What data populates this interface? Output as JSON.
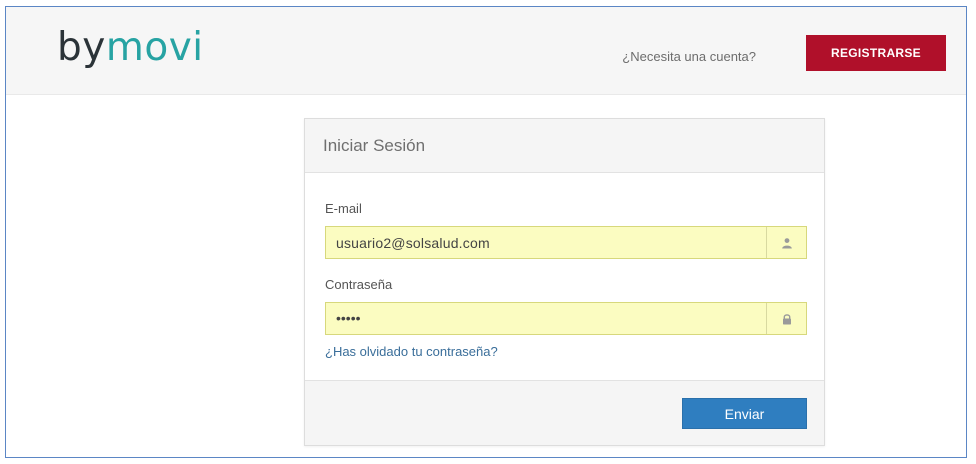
{
  "header": {
    "logo_part1": "by",
    "logo_part2": "movi",
    "need_account_text": "¿Necesita una cuenta?",
    "register_button_label": "REGISTRARSE",
    "register_color": "#b0102a",
    "logo_accent_color": "#27a3a3"
  },
  "login": {
    "title": "Iniciar Sesión",
    "email_label": "E-mail",
    "email_value": "usuario2@solsalud.com",
    "email_icon": "user-icon",
    "password_label": "Contraseña",
    "password_value": "•••••",
    "password_icon": "lock-icon",
    "forgot_link": "¿Has olvidado tu contraseña?",
    "submit_label": "Enviar",
    "submit_color": "#2f7ec0",
    "autofill_color": "#fbfcc1"
  }
}
